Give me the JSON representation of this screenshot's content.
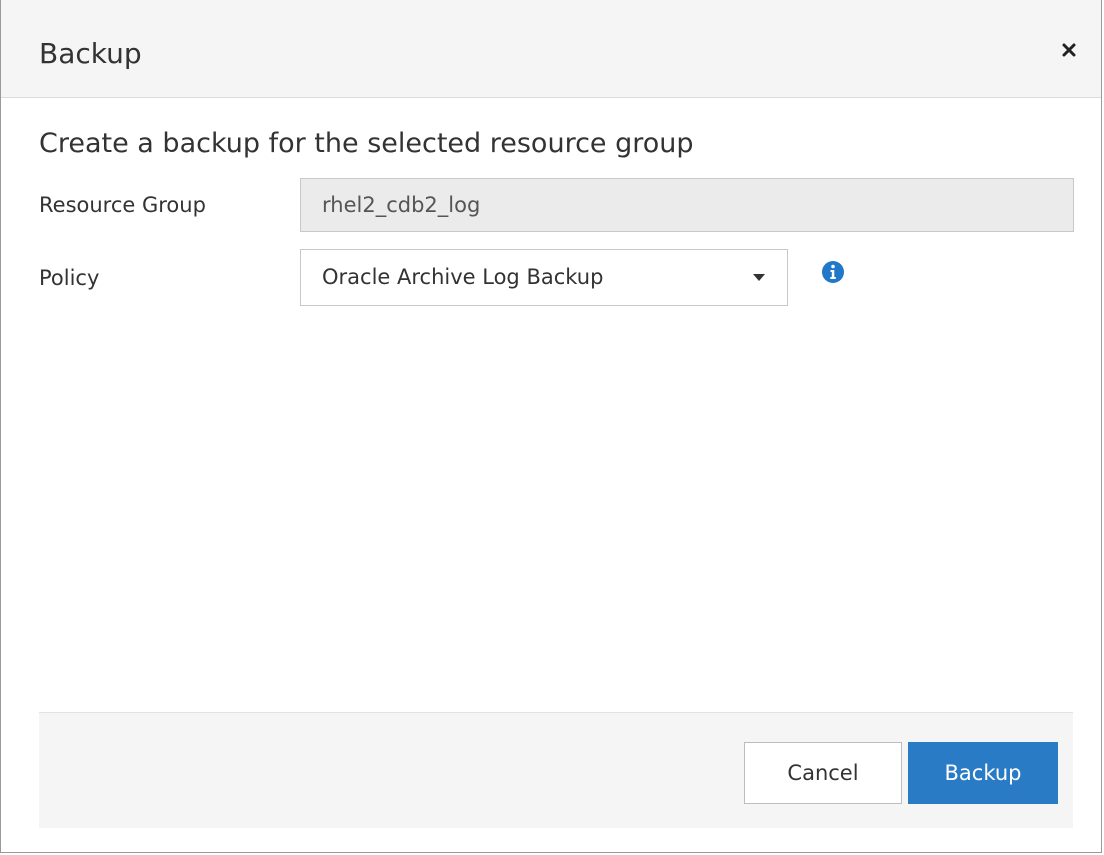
{
  "dialog": {
    "title": "Backup",
    "close_icon": "close-icon"
  },
  "body": {
    "subtitle": "Create a backup for the selected resource group",
    "resource_group": {
      "label": "Resource Group",
      "value": "rhel2_cdb2_log"
    },
    "policy": {
      "label": "Policy",
      "selected": "Oracle Archive Log Backup",
      "caret_icon": "caret-down-icon",
      "info_icon": "info-icon"
    }
  },
  "footer": {
    "cancel_label": "Cancel",
    "backup_label": "Backup"
  },
  "colors": {
    "primary": "#2a7bc6",
    "info": "#1f78c8",
    "header_bg": "#f5f5f5",
    "readonly_bg": "#ebebeb"
  }
}
